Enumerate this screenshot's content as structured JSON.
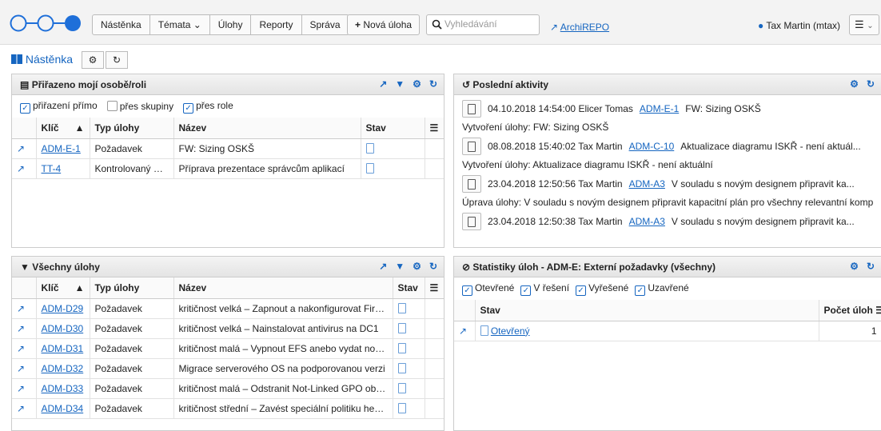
{
  "nav": {
    "items": [
      "Nástěnka",
      "Témata ⌄",
      "Úlohy",
      "Reporty",
      "Správa"
    ],
    "new_task": "Nová úloha",
    "search_placeholder": "Vyhledávání",
    "archi_link": "ArchiREPO",
    "user": "Tax Martin (mtax)"
  },
  "dashboard": {
    "title": "Nástěnka"
  },
  "assigned_panel": {
    "title": "Přiřazeno mojí osobě/roli",
    "filters": [
      {
        "label": "přiřazení přímo",
        "checked": true
      },
      {
        "label": "přes skupiny",
        "checked": false
      },
      {
        "label": "přes role",
        "checked": true
      }
    ],
    "columns": [
      "Klíč",
      "Typ úlohy",
      "Název",
      "Stav"
    ],
    "rows": [
      {
        "key": "ADM-E-1",
        "type": "Požadavek",
        "name": "FW: Sizing OSKŠ"
      },
      {
        "key": "TT-4",
        "type": "Kontrolovaný ú…",
        "name": "Příprava prezentace správcům aplikací"
      }
    ]
  },
  "all_tasks_panel": {
    "title": "Všechny úlohy",
    "columns": [
      "Klíč",
      "Typ úlohy",
      "Název",
      "Stav"
    ],
    "rows": [
      {
        "key": "ADM-D29",
        "type": "Požadavek",
        "name": "kritičnost velká – Zapnout a nakonfigurovat Firew…"
      },
      {
        "key": "ADM-D30",
        "type": "Požadavek",
        "name": "kritičnost velká – Nainstalovat antivirus na DC1"
      },
      {
        "key": "ADM-D31",
        "type": "Požadavek",
        "name": "kritičnost malá – Vypnout EFS anebo vydat nový c…"
      },
      {
        "key": "ADM-D32",
        "type": "Požadavek",
        "name": "Migrace serverového OS na podporovanou verzi"
      },
      {
        "key": "ADM-D33",
        "type": "Požadavek",
        "name": "kritičnost malá – Odstranit Not-Linked GPO objekt…"
      },
      {
        "key": "ADM-D34",
        "type": "Požadavek",
        "name": "kritičnost střední – Zavést speciální politiku he…"
      }
    ]
  },
  "activity_panel": {
    "title": "Poslední aktivity",
    "items": [
      {
        "meta": "04.10.2018 14:54:00 Elicer Tomas",
        "key": "ADM-E-1",
        "text": "FW: Sizing OSKŠ",
        "desc": "Vytvoření úlohy: FW: Sizing OSKŠ"
      },
      {
        "meta": "08.08.2018 15:40:02 Tax Martin",
        "key": "ADM-C-10",
        "text": "Aktualizace diagramu ISKŘ - není aktuál...",
        "desc": "Vytvoření úlohy: Aktualizace diagramu ISKŘ - není aktuální"
      },
      {
        "meta": "23.04.2018 12:50:56 Tax Martin",
        "key": "ADM-A3",
        "text": "V souladu s novým designem připravit ka...",
        "desc": "Úprava úlohy: V souladu s novým designem připravit kapacitní plán pro všechny relevantní komponenty"
      },
      {
        "meta": "23.04.2018 12:50:38 Tax Martin",
        "key": "ADM-A3",
        "text": "V souladu s novým designem připravit ka...",
        "desc": ""
      }
    ]
  },
  "stats_panel": {
    "title": "Statistiky úloh - ADM-E: Externí požadavky (všechny)",
    "filters": [
      {
        "label": "Otevřené",
        "checked": true
      },
      {
        "label": "V řešení",
        "checked": true
      },
      {
        "label": "Vyřešené",
        "checked": true
      },
      {
        "label": "Uzavřené",
        "checked": true
      }
    ],
    "columns": [
      "Stav",
      "Počet úloh"
    ],
    "rows": [
      {
        "state": "Otevřený",
        "count": "1"
      }
    ]
  },
  "colors": {
    "accent": "#1565c0",
    "logo": "#1e6fd9"
  }
}
